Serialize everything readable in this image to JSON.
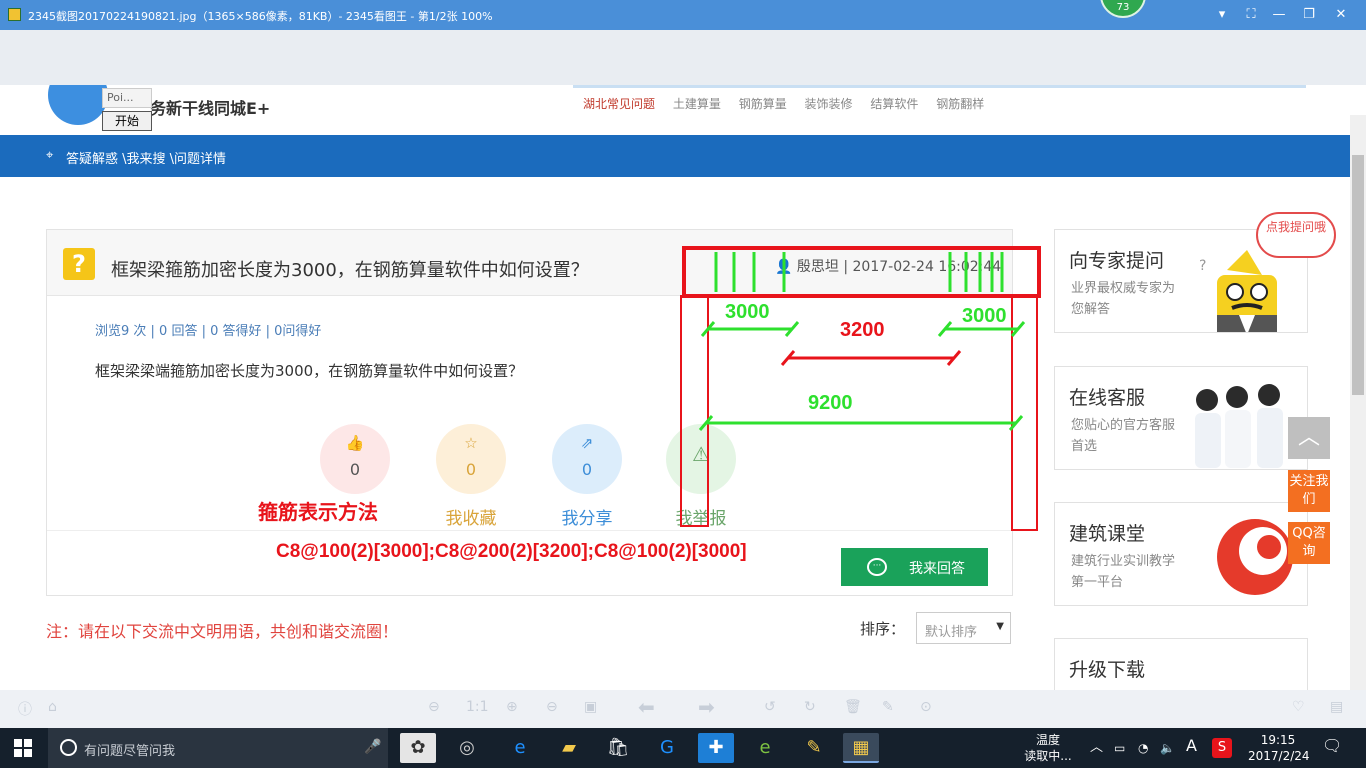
{
  "viewer": {
    "title": "2345截图20170224190821.jpg（1365×586像素，81KB）- 2345看图王 - 第1/2张 100%",
    "badge": "73"
  },
  "page": {
    "poi_placeholder": "Poi...",
    "start_button": "开始",
    "logo_text": "务新干线同城E+",
    "nav": [
      "湖北常见问题",
      "土建算量",
      "钢筋算量",
      "装饰装修",
      "结算软件",
      "钢筋翻样"
    ],
    "breadcrumb": "答疑解惑 \\我来搜 \\问题详情",
    "question": {
      "icon": "?",
      "title": "框架梁箍筋加密长度为3000，在钢筋算量软件中如何设置？",
      "author": "殷思坦",
      "time": "| 2017-02-24 16:02:44",
      "stats": "浏览9 次 | 0 回答 | 0 答得好 | 0问得好",
      "description": "框架梁梁端箍筋加密长度为3000，在钢筋算量软件中如何设置？"
    },
    "actions": [
      {
        "label": "问得好",
        "count": "0",
        "icon": "thumbs-up",
        "color": "#e58a8a",
        "bg": "#fde7e7"
      },
      {
        "label": "我收藏",
        "count": "0",
        "icon": "star",
        "color": "#d9a43a",
        "bg": "#fdefd8"
      },
      {
        "label": "我分享",
        "count": "0",
        "icon": "share",
        "color": "#3d8ed8",
        "bg": "#dcedfb"
      },
      {
        "label": "我举报",
        "count": "",
        "icon": "warning",
        "color": "#6aa56a",
        "bg": "#e4f5e4"
      }
    ],
    "answer_button": "我来回答",
    "note": "注：请在以下交流中文明用语，共创和谐交流圈！",
    "sort_label": "排序：",
    "sort_value": "默认排序",
    "sidebar": [
      {
        "title": "向专家提问",
        "subtitle": "业界最权威专家为您解答",
        "bubble": "点我提问哦"
      },
      {
        "title": "在线客服",
        "subtitle": "您贴心的官方客服首选"
      },
      {
        "title": "建筑课堂",
        "subtitle": "建筑行业实训教学第一平台"
      },
      {
        "title": "升级下载"
      }
    ],
    "float_follow": "关注我们",
    "float_qq": "QQ咨询"
  },
  "annotations": {
    "dim_left": "3000",
    "dim_mid": "3200",
    "dim_right": "3000",
    "dim_total": "9200",
    "method_label": "箍筋表示方法",
    "formula": "C8@100(2)[3000];C8@200(2)[3200];C8@100(2)[3000]",
    "red": "#e8141b",
    "green": "#2ee02e"
  },
  "taskbar": {
    "search_placeholder": "有问题尽管问我",
    "temp_line1": "温度",
    "temp_line2": "读取中...",
    "ime": "A",
    "time": "19:15",
    "date": "2017/2/24"
  }
}
